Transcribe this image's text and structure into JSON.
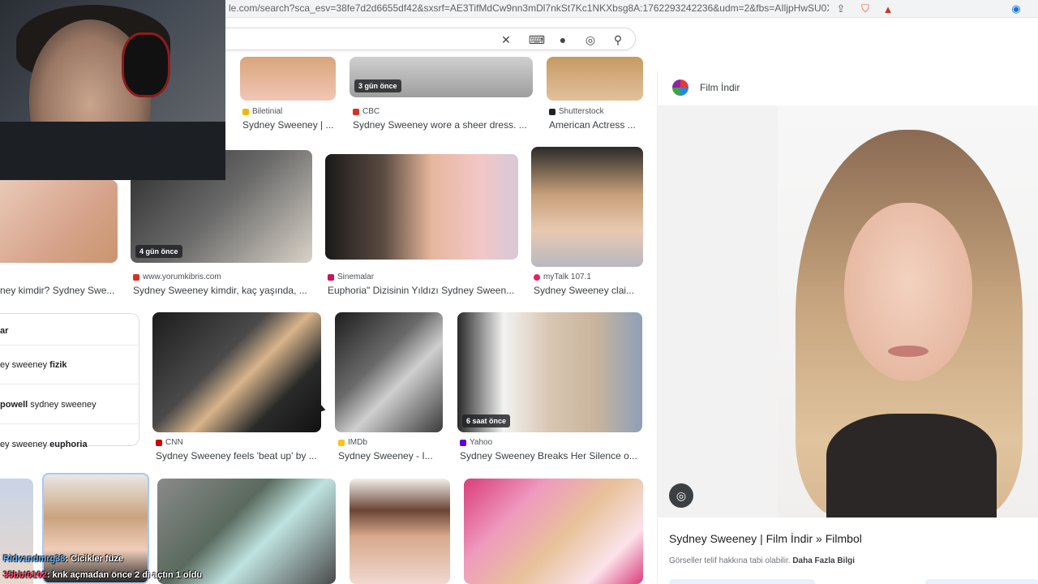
{
  "browser": {
    "url": "le.com/search?sca_esv=38fe7d2d6655df42&sxsrf=AE3TifMdCw9nn3mDl7nkSt7Kc1NKXbsg8A:1762293242236&udm=2&fbs=AIljpHwSU0Xn4FR...",
    "icons": [
      "share-icon",
      "brave-shield-icon",
      "brave-rewards-icon",
      "audio-icon"
    ]
  },
  "search": {
    "icons": [
      "clear-icon",
      "keyboard-icon",
      "microphone-icon",
      "lens-icon",
      "search-icon"
    ]
  },
  "results": {
    "row1": [
      {
        "source": "Biletinial",
        "caption": "Sydney Sweeney | ...",
        "fav_color": "#f4b400"
      },
      {
        "source": "CBC",
        "caption": "Sydney Sweeney wore a sheer dress. ...",
        "badge": "3 gün önce",
        "fav_color": "#d93025"
      },
      {
        "source": "Shutterstock",
        "caption": "American Actress ...",
        "fav_color": "#202124"
      }
    ],
    "row2": [
      {
        "caption": "ney kimdir? Sydney Swe..."
      },
      {
        "source": "www.yorumkibris.com",
        "caption": "Sydney Sweeney kimdir, kaç yaşında, ...",
        "badge": "4 gün önce",
        "fav_color": "#d93025"
      },
      {
        "source": "Sinemalar",
        "caption": "Euphoria\" Dizisinin Yıldızı Sydney Sween...",
        "fav_color": "#c2185b"
      },
      {
        "source": "myTalk 107.1",
        "caption": "Sydney Sweeney clai...",
        "fav_color": "#e91e63"
      }
    ],
    "row3": [
      {
        "source": "CNN",
        "caption": "Sydney Sweeney feels 'beat up' by ...",
        "fav_color": "#cc0000"
      },
      {
        "source": "IMDb",
        "caption": "Sydney Sweeney - I...",
        "fav_color": "#f5c518"
      },
      {
        "source": "Yahoo",
        "caption": "Sydney Sweeney Breaks Her Silence o...",
        "badge": "6 saat önce",
        "fav_color": "#6001d2"
      }
    ]
  },
  "related": {
    "header": "ar",
    "items": [
      {
        "pre": "ey sweeney ",
        "bold": "fizik"
      },
      {
        "bold": "powell",
        "post": " sydney sweeney"
      },
      {
        "pre": "ey sweeney ",
        "bold": "euphoria"
      }
    ]
  },
  "preview": {
    "site": "Film İndir",
    "title": "Sydney Sweeney | Film İndir » Filmbol",
    "notice": "Görseller telif hakkına tabi olabilir.",
    "more": "Daha Fazla Bilgi"
  },
  "chat": [
    {
      "user": "Ridvandmrg38",
      "message": ": Cicikler füze"
    },
    {
      "user": "35bbt0102",
      "message": ": knk açmadan önce 2 di açtın 1 oldu"
    }
  ]
}
